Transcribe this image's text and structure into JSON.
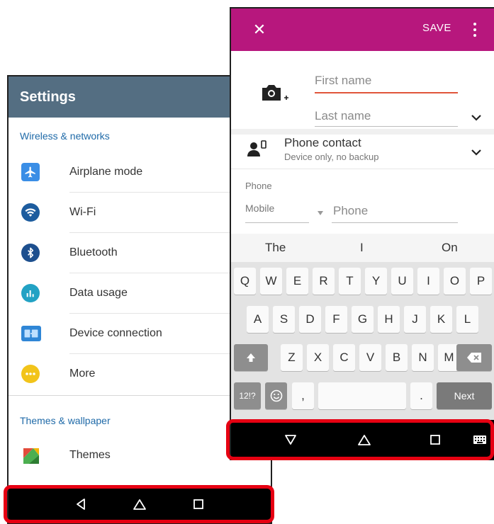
{
  "settings": {
    "title": "Settings",
    "sections": {
      "wireless": "Wireless & networks",
      "themes": "Themes & wallpaper"
    },
    "items": [
      {
        "label": "Airplane mode",
        "icon": "airplane-icon",
        "color": "#3a8ee6"
      },
      {
        "label": "Wi-Fi",
        "icon": "wifi-icon",
        "color": "#1d5c9e"
      },
      {
        "label": "Bluetooth",
        "icon": "bluetooth-icon",
        "color": "#1d4f8e"
      },
      {
        "label": "Data usage",
        "icon": "data-usage-icon",
        "color": "#22a2c4"
      },
      {
        "label": "Device connection",
        "icon": "device-connection-icon",
        "color": "#2f86d6"
      },
      {
        "label": "More",
        "icon": "more-icon",
        "color": "#f2c41a"
      }
    ],
    "themes_item": {
      "label": "Themes",
      "icon": "themes-icon"
    }
  },
  "contact": {
    "save_label": "SAVE",
    "first_name_placeholder": "First name",
    "last_name_placeholder": "Last name",
    "account_title": "Phone contact",
    "account_subtitle": "Device only, no backup",
    "phone_section_label": "Phone",
    "phone_type": "Mobile",
    "phone_placeholder": "Phone"
  },
  "keyboard": {
    "suggestions": [
      "The",
      "I",
      "On"
    ],
    "rows": [
      [
        "Q",
        "W",
        "E",
        "R",
        "T",
        "Y",
        "U",
        "I",
        "O",
        "P"
      ],
      [
        "A",
        "S",
        "D",
        "F",
        "G",
        "H",
        "J",
        "K",
        "L"
      ],
      [
        "Z",
        "X",
        "C",
        "V",
        "B",
        "N",
        "M"
      ]
    ],
    "symbols_key": "12!?",
    "comma_key": ",",
    "period_key": ".",
    "next_key": "Next"
  },
  "colors": {
    "settings_header": "#546e82",
    "contact_appbar": "#b7177d",
    "section_title": "#1f6aa8",
    "highlight": "#e60012",
    "first_name_underline": "#e0553a"
  }
}
